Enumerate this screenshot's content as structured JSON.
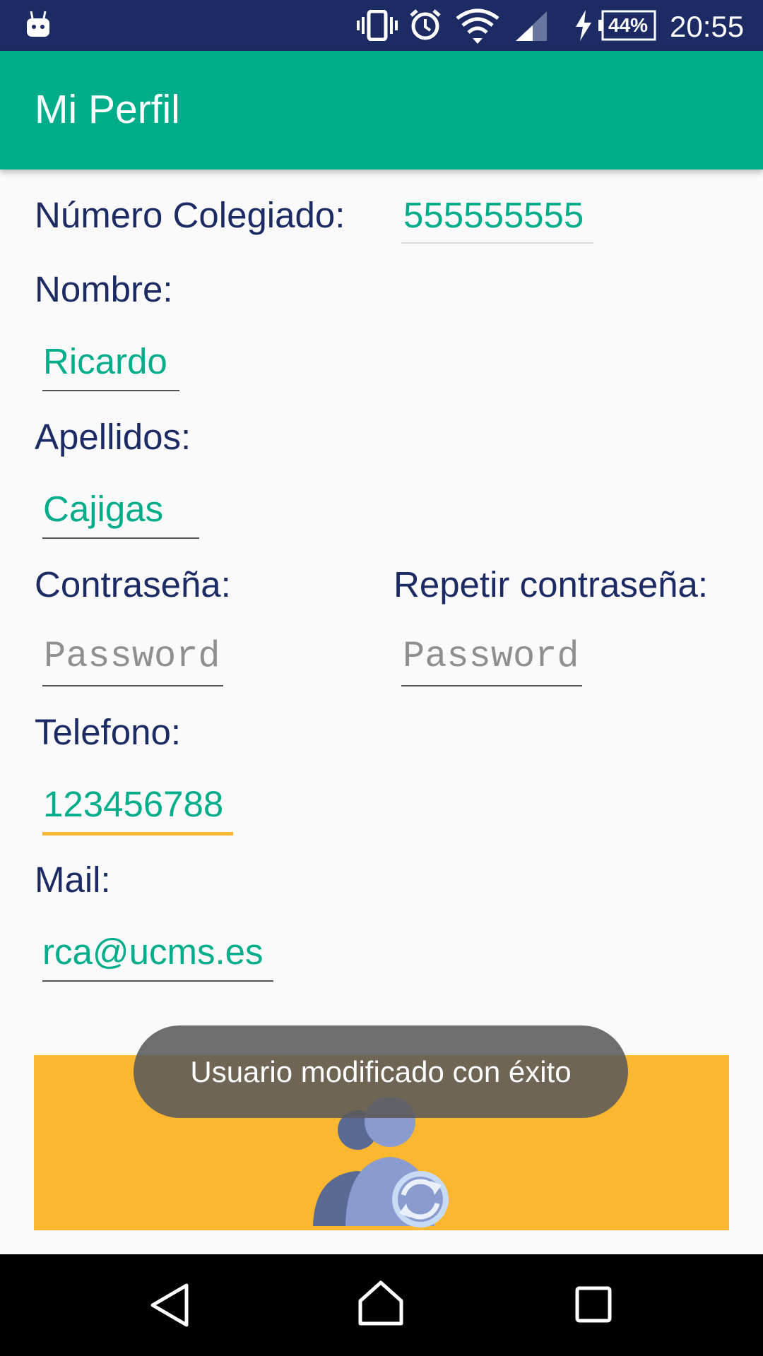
{
  "status_bar": {
    "battery": "44%",
    "time": "20:55",
    "icons": [
      "android-debug-icon",
      "vibrate-icon",
      "alarm-icon",
      "wifi-icon",
      "signal-icon",
      "charging-icon",
      "battery-icon"
    ]
  },
  "app_bar": {
    "title": "Mi Perfil"
  },
  "form": {
    "numero_colegiado": {
      "label": "Número Colegiado:",
      "value": "555555555"
    },
    "nombre": {
      "label": "Nombre:",
      "value": "Ricardo"
    },
    "apellidos": {
      "label": "Apellidos:",
      "value": "Cajigas"
    },
    "contrasena": {
      "label": "Contraseña:",
      "placeholder": "Password"
    },
    "repetir_contrasena": {
      "label": "Repetir contraseña:",
      "placeholder": "Password"
    },
    "telefono": {
      "label": "Telefono:",
      "value": "123456788"
    },
    "mail": {
      "label": "Mail:",
      "value": "rca@ucms.es"
    }
  },
  "update_button": {
    "icon": "users-refresh-icon"
  },
  "toast": {
    "message": "Usuario modificado con éxito"
  },
  "nav_bar": {
    "icons": [
      "back-icon",
      "home-icon",
      "recents-icon"
    ]
  },
  "colors": {
    "status_bar": "#1c2b64",
    "app_bar": "#00ad8a",
    "label": "#1c2b64",
    "value": "#00ad8a",
    "accent": "#fbb72f"
  }
}
